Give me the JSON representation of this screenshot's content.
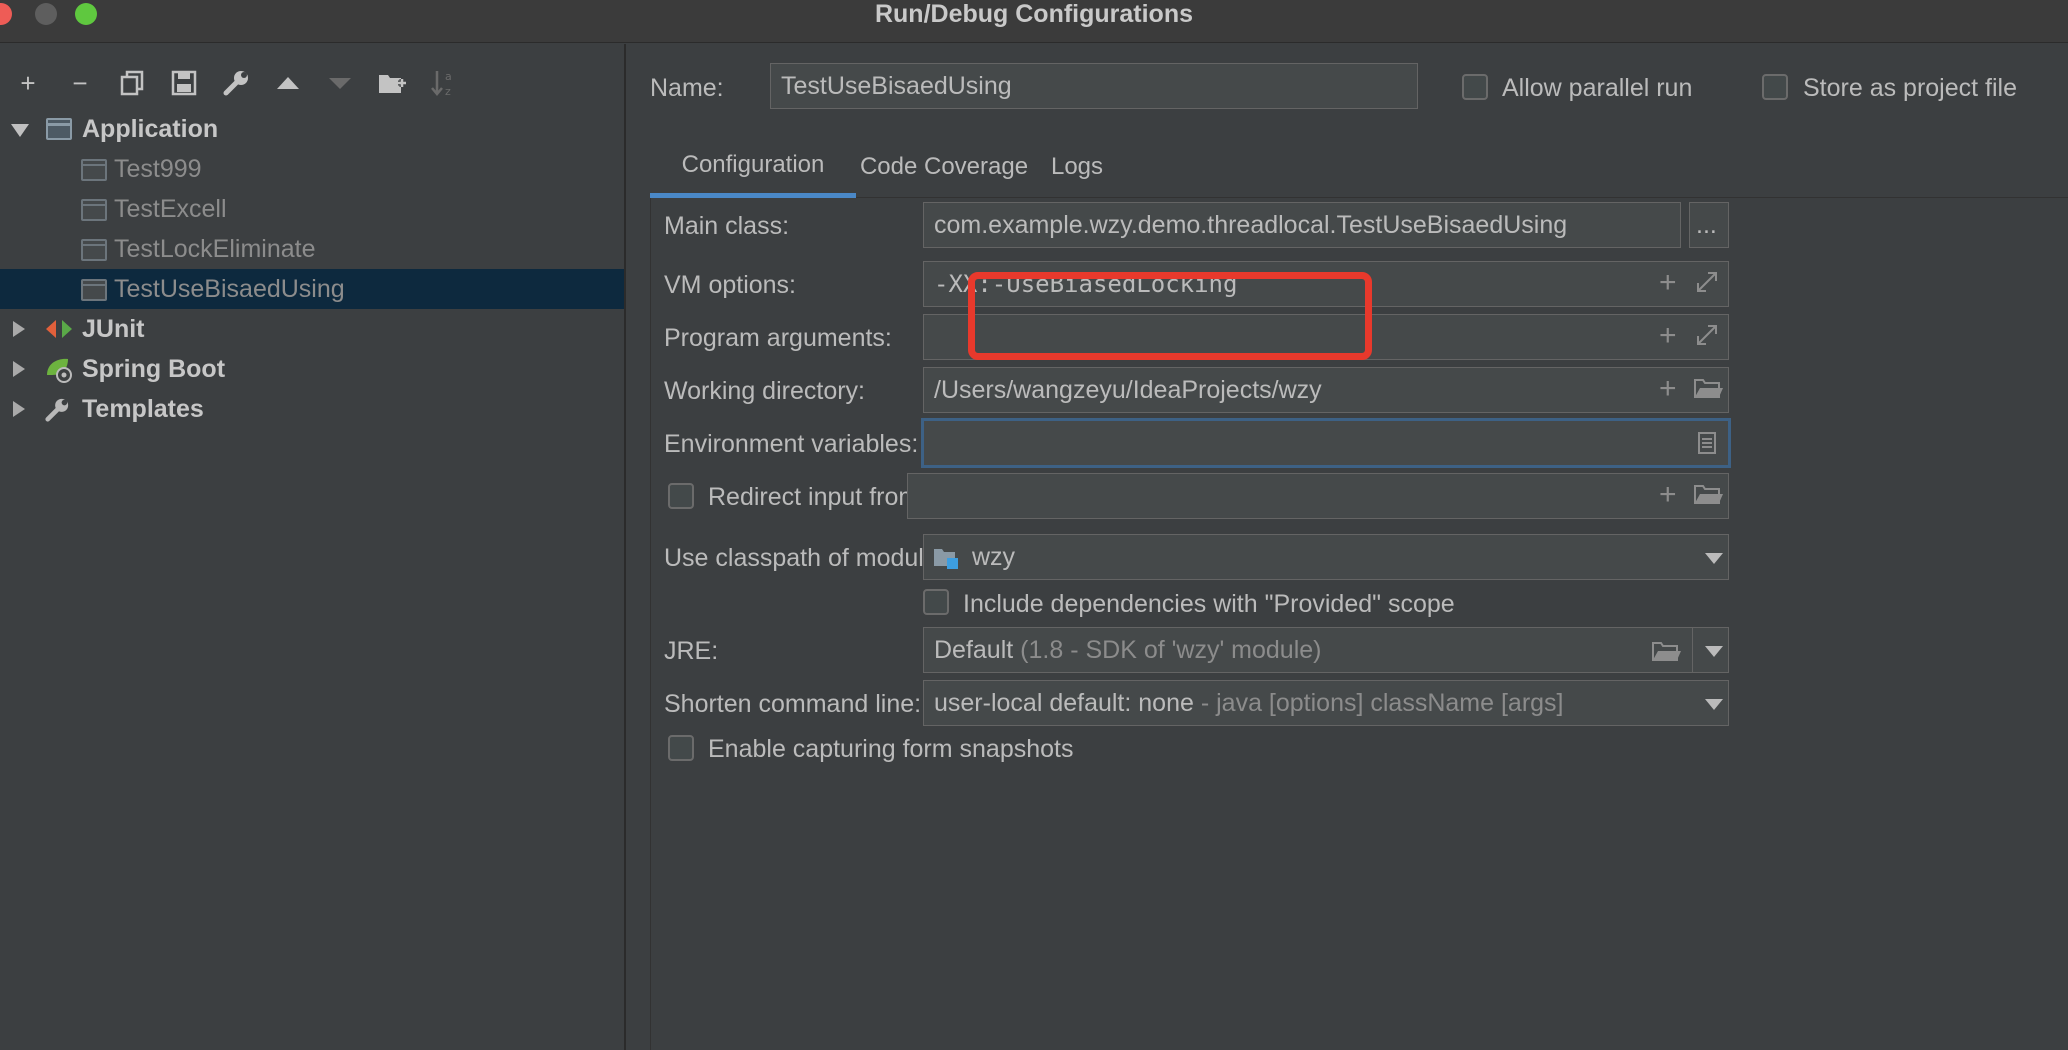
{
  "window": {
    "title": "Run/Debug Configurations"
  },
  "toolbar": {
    "buttons": [
      "add",
      "remove",
      "copy",
      "save",
      "edit-templates",
      "move-up",
      "move-down",
      "new-folder",
      "sort"
    ]
  },
  "tree": {
    "application": {
      "label": "Application",
      "children": [
        "Test999",
        "TestExcell",
        "TestLockEliminate",
        "TestUseBisaedUsing"
      ],
      "selected": "TestUseBisaedUsing"
    },
    "junit": {
      "label": "JUnit"
    },
    "spring_boot": {
      "label": "Spring Boot"
    },
    "templates": {
      "label": "Templates"
    }
  },
  "header": {
    "name_label": "Name:",
    "name_value": "TestUseBisaedUsing",
    "allow_parallel_label": "Allow parallel run",
    "store_project_label": "Store as project file"
  },
  "tabs": [
    "Configuration",
    "Code Coverage",
    "Logs"
  ],
  "form": {
    "main_class_label": "Main class:",
    "main_class_value": "com.example.wzy.demo.threadlocal.TestUseBisaedUsing",
    "browse_button": "...",
    "vm_options_label": "VM options:",
    "vm_options_value": "-XX:-UseBiasedLocking",
    "program_args_label": "Program arguments:",
    "program_args_value": "",
    "working_dir_label": "Working directory:",
    "working_dir_value": "/Users/wangzeyu/IdeaProjects/wzy",
    "env_vars_label": "Environment variables:",
    "env_vars_value": "",
    "redirect_label": "Redirect input from:",
    "classpath_label": "Use classpath of module:",
    "classpath_value": "wzy",
    "include_deps_label": "Include dependencies with \"Provided\" scope",
    "jre_label": "JRE:",
    "jre_value": "Default",
    "jre_hint": "(1.8 - SDK of 'wzy' module)",
    "shorten_label": "Shorten command line:",
    "shorten_value": "user-local default: none",
    "shorten_hint": "- java [options] className [args]",
    "snapshots_label": "Enable capturing form snapshots"
  },
  "colors": {
    "accent": "#4a88c7",
    "highlight": "#e8392c",
    "selection": "#0d293e"
  }
}
